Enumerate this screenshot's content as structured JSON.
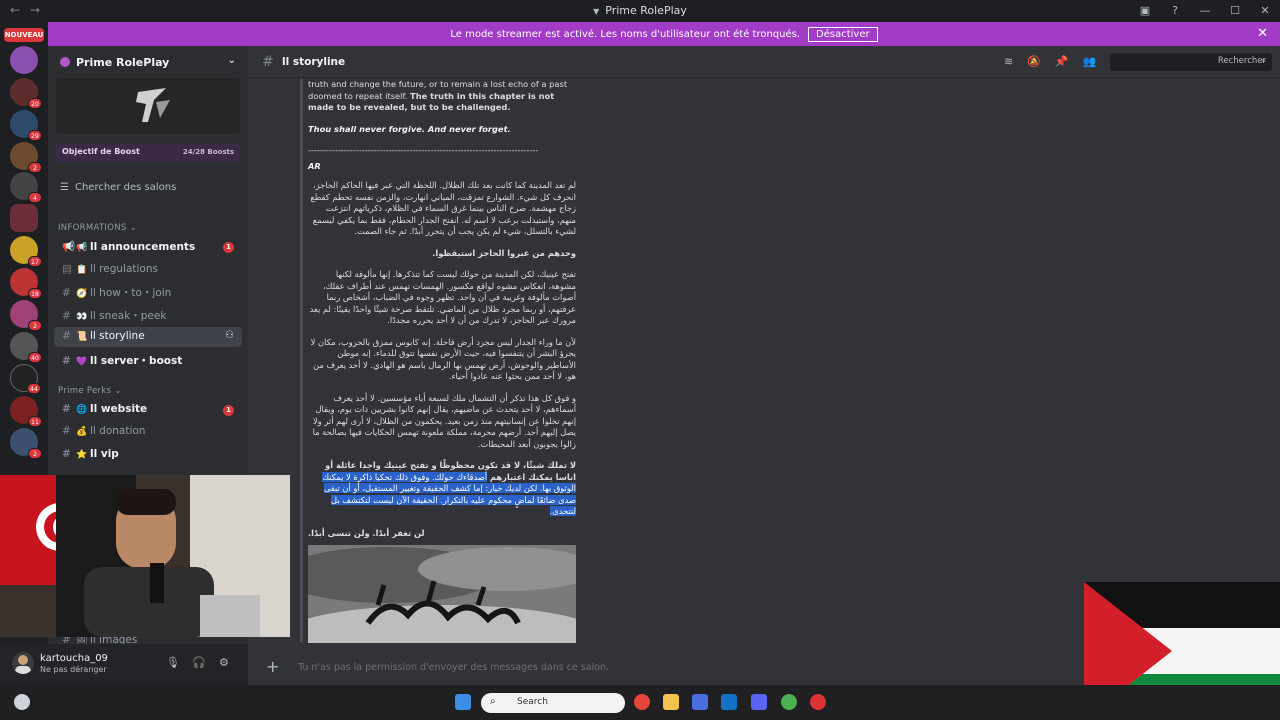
{
  "window": {
    "title": "Prime RolePlay"
  },
  "banner": {
    "message": "Le mode streamer est activé. Les noms d'utilisateur ont été tronqués.",
    "button": "Désactiver"
  },
  "servers": {
    "new_label": "NOUVEAU",
    "badges": [
      "20",
      "29",
      "2",
      "4",
      "17",
      "18",
      "2",
      "40",
      "44",
      "11",
      "2"
    ]
  },
  "sidebar": {
    "server_name": "Prime RolePlay",
    "boost_label": "Objectif de Boost",
    "boost_count": "24/28 Boosts",
    "search_label": "Chercher des salons",
    "categories": {
      "informations": "INFORMATIONS",
      "perks": "Prime Perks"
    },
    "channels": [
      {
        "emoji": "📢",
        "label": "ll announcements",
        "badge": "1"
      },
      {
        "emoji": "📋",
        "label": "ll regulations"
      },
      {
        "emoji": "🧭",
        "label": "ll how・to・join"
      },
      {
        "emoji": "👀",
        "label": "ll sneak・peek"
      },
      {
        "emoji": "📜",
        "label": "ll storyline"
      },
      {
        "emoji": "💜",
        "label": "ll server・boost"
      },
      {
        "emoji": "🌐",
        "label": "ll website",
        "badge": "1"
      },
      {
        "emoji": "💰",
        "label": "ll donation"
      },
      {
        "emoji": "⭐",
        "label": "ll vip"
      },
      {
        "emoji": "🖼",
        "label": "ll images"
      }
    ]
  },
  "user": {
    "name": "kartoucha_09",
    "status": "Ne pas déranger"
  },
  "header": {
    "channel": "ll storyline",
    "search_placeholder": "Rechercher"
  },
  "message": {
    "p1": "truth and change the future, or to remain a lost echo of a past doomed to repeat itself.",
    "p1_bold": "The truth in this chapter is not made to be revealed, but to be challenged.",
    "p2": "Thou shall never forgive. And never forget.",
    "divider": "-----------------------------------------------------------------------------",
    "ar_label": "AR",
    "ar1": "لم تعد المدينة كما كانت بعد تلك الظلال. اللحظة التي عبر فيها الحاكم الحاجز، انحرف كل شيء. الشوارع تمزقت، المباني انهارت، والزمن نفسه تحطم كقطع زجاج مهشمة. صرخ الناس بينما غرق السماء في الظلام، ذكرياتهم انتزعت منهم، واستبدلت برعب لا اسم له. انفتح الجدار الحطام، فقط بما يكفي ليسمع لشيء بالتسلل، شيء لم يكن يجب أن يتحرر أبدًا. ثم جاء الصمت.",
    "ar2": "وحدهم من عبروا الحاجز استيقظوا.",
    "ar3": "تفتح عينيك، لكن المدينة من حولك ليست كما تتذكرها. إنها مألوفة لكنها مشوهة، انعكاس مشوه لواقع مكسور. الهمسات تهمس عند أطراف عقلك، أصوات مألوفة وغريبة في آن واحد. تظهر وجوه في الضباب، أشخاص ربما عرفتهم، أو ربما مجرد ظلال من الماضي. تلتقط صرخة شيئًا واحدًا يقينًا: لم يعد مرورك عبر الحاجز، لا تدرك من أن لا أحد يحرره مجددًا.",
    "ar4": "لأن ما وراء الجدار ليس مجرد أرض قاحلة. إنه كابوس ممزق بالحروب، مكان لا يجرؤ البشر أن يتنفسوا فيه، حيث الأرض نفسها تتوق للدماء. إنه موطن الأساطير والوحوش، أرض تهمس بها الرمال باسم هو الهادي. لا أحد يعرف من هو، لا أحد ممن بحثوا عنه عادوا أحياء.",
    "ar5": "و فوق كل هذا تذكر أن التشمال ملك لسبعة أباء مؤسسين. لا أحد يعرف أسماءهم، لا أحد يتحدث عن ماضيهم، يقال إنهم كانوا بشريين ذات يوم، ويقال إنهم تخلوا عن إنسانيتهم منذ زمن بعيد. يحكمون من الظلال، لا أرى لهم أثر ولا يصل إليهم أحد. أرضهم محرمة، مملكة ملعونة تهمس الحكايات فيها بصالحة ما زالوا يجوبون أبعد المحيطات.",
    "ar6_a": "لا تملك شيئًا، لا قد تكون محظوظًا و تفتح عينيك واجدا عائلة أو اناسا يمكنك اعتبارهم",
    "ar6_sel": "أصدقاءك حولك. وفوق ذلك تحكيا ذاكرة لا يمكنك الوثوق بها. لكن لديك خيار: إما كشف الحقيقة وتغيير المستقبل، أو أن تبقى صدى ضائعًا لماضٍ محكوم عليه بالتكرار. الحقيقة الآن ليست لتكتشف بل لتتحدى.",
    "ar7": "لن تغفر أبدًا. ولن تنسى أبدًا."
  },
  "composer": {
    "placeholder": "Tu n'as pas la permission d'envoyer des messages dans ce salon."
  },
  "taskbar": {
    "search": "Search"
  }
}
